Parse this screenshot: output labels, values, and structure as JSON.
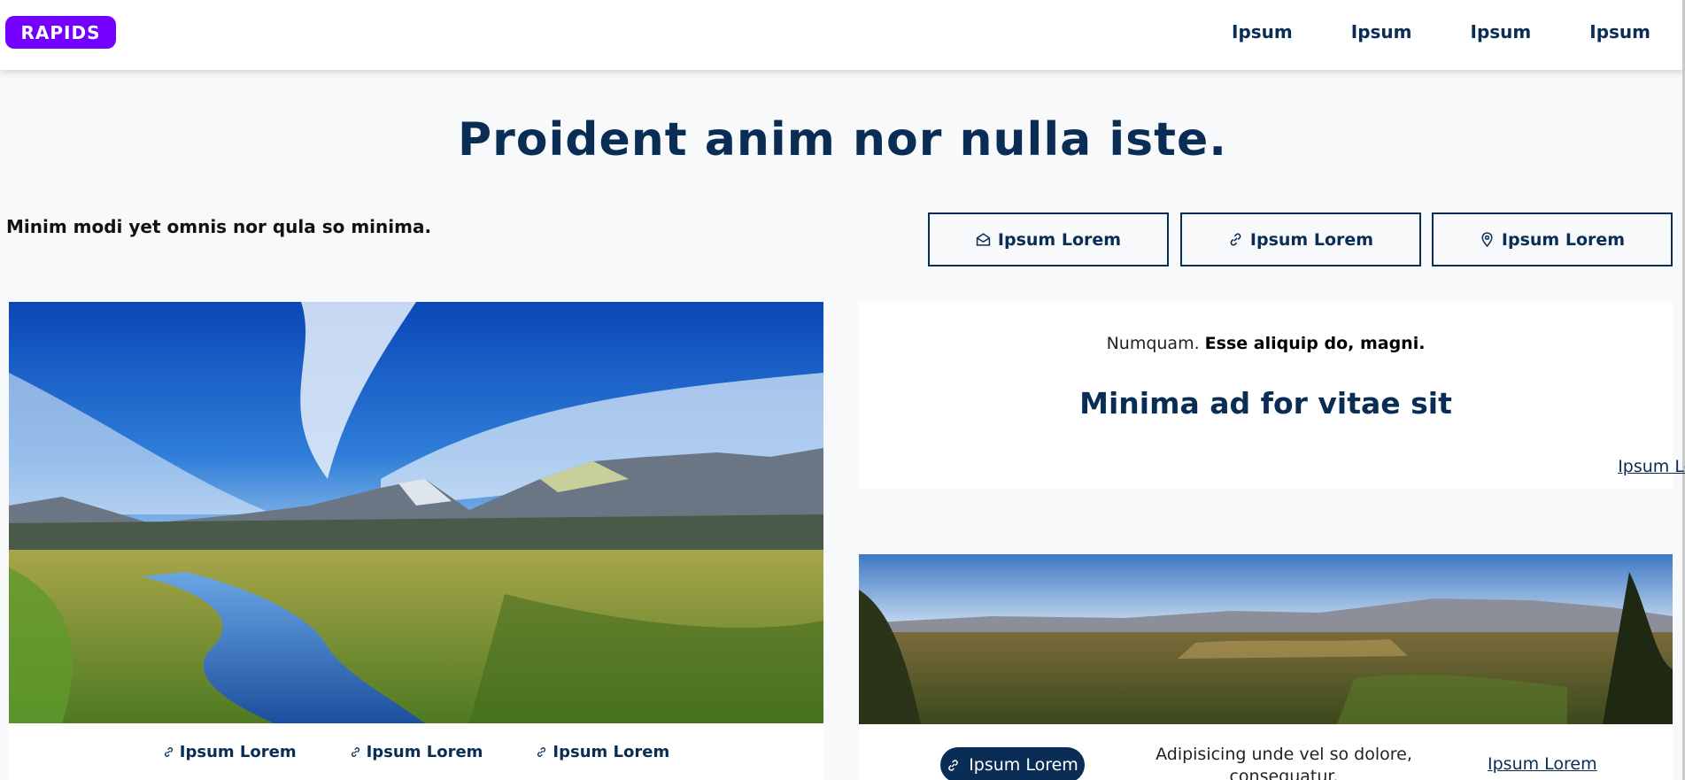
{
  "header": {
    "logo_text": "RAPIDS",
    "nav": [
      "Ipsum",
      "Ipsum",
      "Ipsum",
      "Ipsum"
    ],
    "brand_color": "#7300ff"
  },
  "hero": {
    "headline_light": "Proident anim ",
    "headline_bold": "nor nulla iste.",
    "tagline": "Minim modi yet omnis nor qula so minima."
  },
  "actions": [
    {
      "label": "Ipsum Lorem",
      "icon": "envelope-open-icon"
    },
    {
      "label": "Ipsum Lorem",
      "icon": "link-icon"
    },
    {
      "label": "Ipsum Lorem",
      "icon": "map-pin-icon"
    }
  ],
  "hero_links": [
    "Ipsum Lorem",
    "Ipsum Lorem",
    "Ipsum Lorem"
  ],
  "card": {
    "kicker_plain": "Numquam. ",
    "kicker_bold": "Esse aliquip do, magni.",
    "title": "Minima ad for vitae sit",
    "link": "Ipsum Lorem"
  },
  "panorama": {
    "pill_label": "Ipsum Lorem",
    "text": "Adipisicing unde vel so dolore, consequatur.",
    "link": "Ipsum Lorem"
  },
  "colors": {
    "navy": "#0a2d56",
    "background": "#f8f9fa"
  }
}
